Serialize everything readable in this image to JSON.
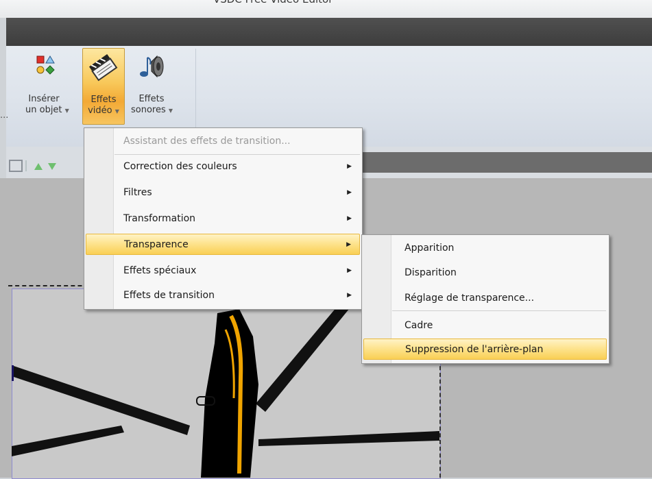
{
  "window": {
    "title": "VSDC Free Video Editor"
  },
  "ribbon": {
    "buttons": [
      {
        "line1": "Insérer",
        "line2": "un objet",
        "icon": "shapes-icon"
      },
      {
        "line1": "Effets",
        "line2": "vidéo",
        "icon": "clapperboard-icon"
      },
      {
        "line1": "Effets",
        "line2": "sonores",
        "icon": "speaker-icon"
      }
    ],
    "partial_left_text": "..."
  },
  "menu": {
    "items": [
      {
        "label": "Assistant des effets de transition...",
        "disabled": true
      },
      {
        "label": "Correction des couleurs",
        "submenu": true
      },
      {
        "label": "Filtres",
        "submenu": true
      },
      {
        "label": "Transformation",
        "submenu": true
      },
      {
        "label": "Transparence",
        "submenu": true,
        "highlighted": true
      },
      {
        "label": "Effets spéciaux",
        "submenu": true
      },
      {
        "label": "Effets de transition",
        "submenu": true
      }
    ]
  },
  "submenu": {
    "items": [
      {
        "label": "Apparition"
      },
      {
        "label": "Disparition"
      },
      {
        "label": "Réglage de transparence..."
      },
      {
        "label": "Cadre"
      },
      {
        "label": "Suppression de l'arrière-plan",
        "highlighted": true
      }
    ]
  },
  "colors": {
    "highlight": "#f9cf55",
    "active_button": "#f3a935"
  }
}
